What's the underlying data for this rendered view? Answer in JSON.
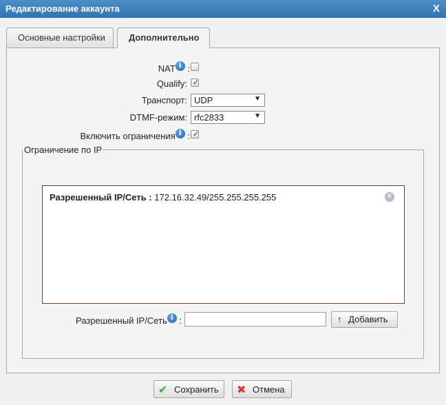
{
  "window": {
    "title": "Редактирование аккаунта",
    "close_label": "X"
  },
  "tabs": [
    {
      "label": "Основные настройки"
    },
    {
      "label": "Дополнительно"
    }
  ],
  "fields": {
    "nat": {
      "label": "NAT",
      "checked": false
    },
    "qualify": {
      "label": "Qualify:",
      "checked": true
    },
    "transport": {
      "label": "Транспорт:",
      "value": "UDP"
    },
    "dtmf": {
      "label": "DTMF-режим:",
      "value": "rfc2833"
    },
    "restrict": {
      "label": "Включить ограничения",
      "checked": true
    }
  },
  "ip_restriction": {
    "legend": "Ограничение по IP",
    "entries": [
      {
        "label": "Разрешенный IP/Сеть :",
        "value": "172.16.32.49/255.255.255.255"
      }
    ],
    "input_label": "Разрешенный IP/Сеть",
    "input_value": "",
    "add_label": "Добавить"
  },
  "buttons": {
    "save_label": "Сохранить",
    "cancel_label": "Отмена"
  },
  "icons": {
    "info": "info-icon",
    "remove": "remove-circle-icon",
    "add": "arrow-up-icon",
    "save": "checkmark-icon",
    "cancel": "cross-icon"
  },
  "colors": {
    "title_bar": "#2f73b0",
    "save_icon": "#3aa83a",
    "cancel_icon": "#d9342b"
  }
}
